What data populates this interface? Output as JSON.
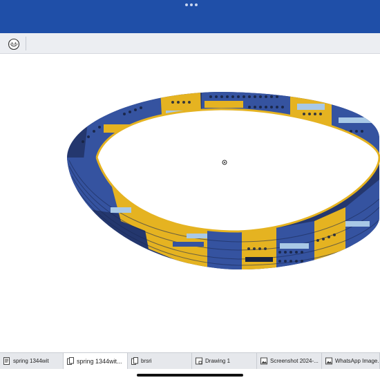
{
  "window": {
    "more_icon": "ellipsis-icon"
  },
  "toolbar": {
    "face_icon": "smiley-face-icon"
  },
  "viewport": {
    "model": "ring-spring-assembly-3d",
    "colors": {
      "gold": "#e5b321",
      "blue": "#3553a0",
      "light_blue": "#a9c9e6",
      "dark": "#17223f",
      "grey": "#8a94a3"
    }
  },
  "tabs": [
    {
      "label": "spring 1344wit",
      "icon": "part-document-icon",
      "active": false
    },
    {
      "label": "spring 1344wit...",
      "icon": "assembly-document-icon",
      "active": true
    },
    {
      "label": "brsri",
      "icon": "assembly-document-icon",
      "active": false
    },
    {
      "label": "Drawing 1",
      "icon": "drawing-document-icon",
      "active": false
    },
    {
      "label": "Screenshot 2024-...",
      "icon": "image-document-icon",
      "active": false
    },
    {
      "label": "WhatsApp Image...",
      "icon": "image-document-icon",
      "active": false
    }
  ]
}
